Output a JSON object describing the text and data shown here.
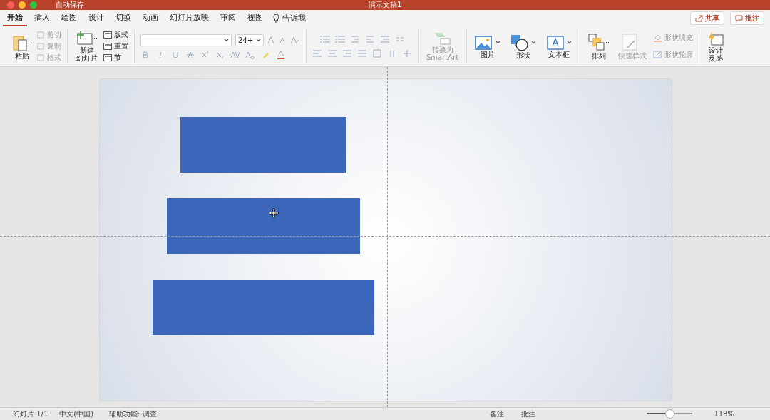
{
  "window": {
    "title": "演示文稿1",
    "autosave": "自动保存"
  },
  "tabs": [
    {
      "label": "开始",
      "selected": true
    },
    {
      "label": "插入",
      "selected": false
    },
    {
      "label": "绘图",
      "selected": false
    },
    {
      "label": "设计",
      "selected": false
    },
    {
      "label": "切换",
      "selected": false
    },
    {
      "label": "动画",
      "selected": false
    },
    {
      "label": "幻灯片放映",
      "selected": false
    },
    {
      "label": "审阅",
      "selected": false
    },
    {
      "label": "视图",
      "selected": false
    }
  ],
  "tell_me": "告诉我",
  "share_button": "共享",
  "comments_button": "批注",
  "clipboard": {
    "paste": "粘贴",
    "items": [
      {
        "label": "剪切",
        "disabled": true
      },
      {
        "label": "复制",
        "disabled": true
      },
      {
        "label": "格式",
        "disabled": true
      }
    ]
  },
  "slides": {
    "new_slide": [
      "新建",
      "幻灯片"
    ],
    "items": [
      {
        "label": "版式",
        "disabled": false
      },
      {
        "label": "重置",
        "disabled": false
      },
      {
        "label": "节",
        "disabled": false
      }
    ]
  },
  "font": {
    "size": "24+"
  },
  "convert": {
    "label": [
      "转换为",
      "SmartArt"
    ],
    "disabled": true
  },
  "insert": [
    {
      "label": "图片",
      "kind": "picture"
    },
    {
      "label": "形状",
      "kind": "shapes"
    },
    {
      "label": "文本框",
      "kind": "textbox"
    }
  ],
  "arrange": {
    "label": "排列"
  },
  "quick_styles": {
    "label": "快速样式",
    "disabled": true
  },
  "shape_format": [
    {
      "label": "形状填充",
      "kind": "fill",
      "disabled": true
    },
    {
      "label": "形状轮廓",
      "kind": "outline",
      "disabled": true
    }
  ],
  "design_ideas": {
    "label": [
      "设计",
      "灵感"
    ]
  },
  "slide": {
    "shapes": [
      {
        "kind": "rectangle"
      },
      {
        "kind": "rectangle"
      },
      {
        "kind": "rectangle"
      }
    ]
  },
  "status_bar": {
    "slide_counter": "幻灯片 1/1",
    "language": "中文(中国)",
    "accessibility": "辅助功能: 调查",
    "notes": "备注",
    "comments": "批注",
    "zoom": "113%",
    "zoom_slider": {
      "level": 0.5
    }
  }
}
